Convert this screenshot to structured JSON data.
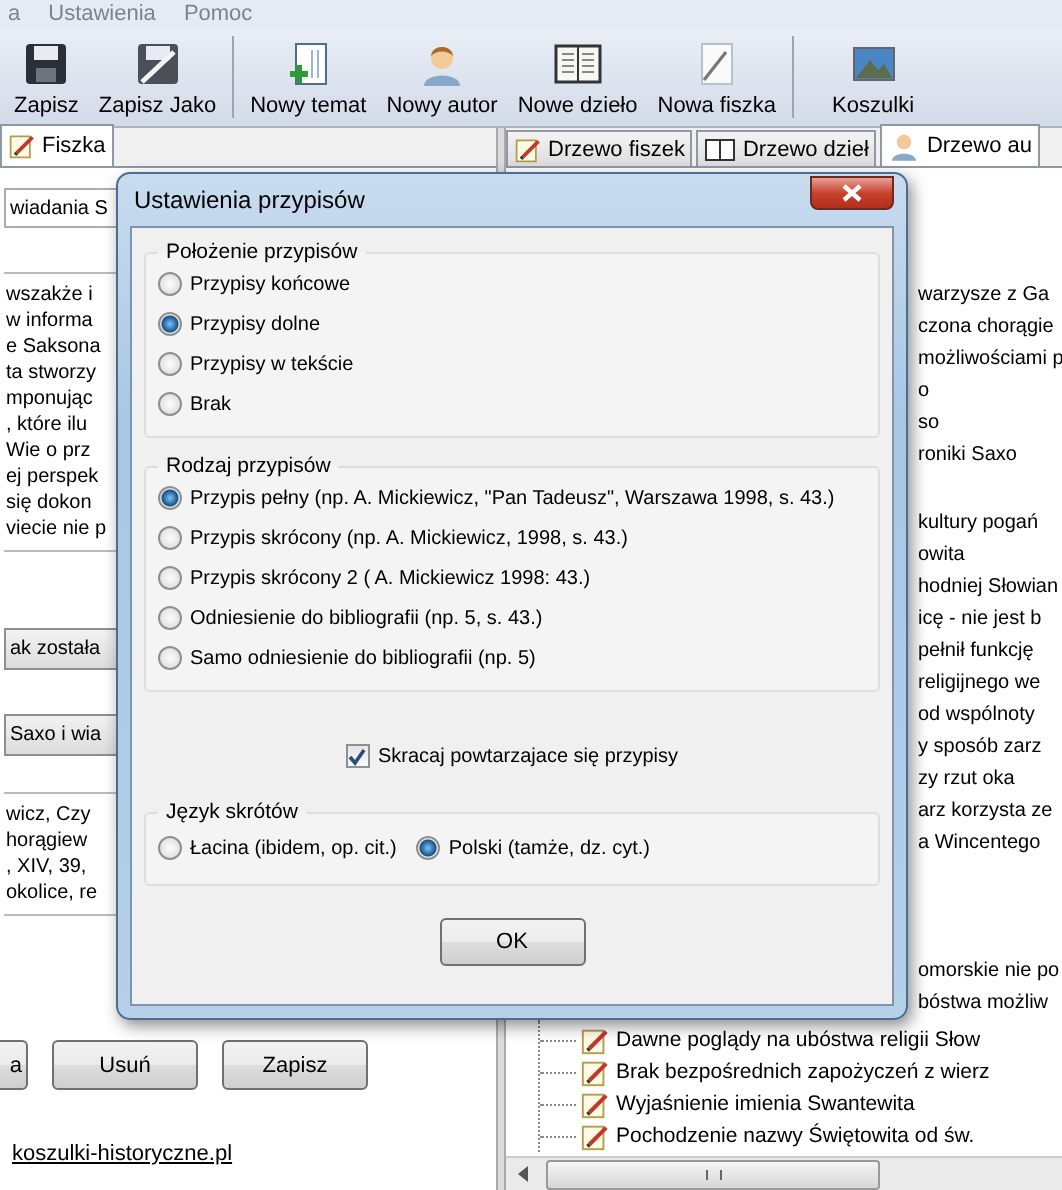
{
  "menu": [
    "a",
    "Ustawienia",
    "Pomoc"
  ],
  "toolbar": {
    "groups": [
      [
        "Zapisz",
        "Zapisz Jako"
      ],
      [
        "Nowy temat",
        "Nowy autor",
        "Nowe dzieło",
        "Nowa fiszka"
      ],
      [
        "Koszulki"
      ]
    ]
  },
  "left_panel": {
    "tabs": [
      {
        "label": "Fiszka",
        "selected": true
      }
    ],
    "title_field": "wiadania S",
    "text_lines": [
      "wszakże i",
      "w informa",
      "e Saksona",
      "ta stworzy",
      "mponując",
      ", które ilu",
      "Wie o prz",
      "ej perspek",
      "się dokon",
      "viecie nie p"
    ],
    "field_1": "ak została",
    "field_2": "Saxo i wia",
    "source_lines": [
      "wicz, Czy",
      "horągiew",
      ", XIV, 39,",
      "okolice, re"
    ],
    "buttons": [
      "a",
      "Usuń",
      "Zapisz"
    ],
    "link": "koszulki-historyczne.pl"
  },
  "right_panel": {
    "tabs": [
      {
        "label": "Drzewo fiszek",
        "selected": false
      },
      {
        "label": "Drzewo dzieł",
        "selected": false
      },
      {
        "label": "Drzewo au",
        "selected": true
      }
    ],
    "tree_row_groups": [
      [
        "warzysze z Ga",
        "czona chorągie",
        "możliwościami p",
        "o",
        "so",
        "roniki Saxo"
      ],
      [
        "kultury pogań",
        "owita",
        "hodniej Słowian",
        "icę - nie jest b",
        "pełnił funkcję",
        "religijnego we",
        "od wspólnoty",
        "y sposób zarz",
        "zy rzut oka",
        "arz korzysta ze",
        "a Wincentego"
      ],
      [
        "omorskie nie po",
        "bóstwa możliw"
      ]
    ],
    "tree_items": [
      "Dawne poglądy na ubóstwa religii Słow",
      "Brak bezpośrednich zapożyczeń z wierz",
      "Wyjaśnienie imienia Swantewita",
      "Pochodzenie nazwy Świętowita od św."
    ]
  },
  "dialog": {
    "title": "Ustawienia przypisów",
    "sections": [
      {
        "kind": "radio_column",
        "legend": "Położenie przypisów",
        "options": [
          {
            "label": "Przypisy końcowe",
            "selected": false
          },
          {
            "label": "Przypisy dolne",
            "selected": true
          },
          {
            "label": "Przypisy w tekście",
            "selected": false
          },
          {
            "label": "Brak",
            "selected": false
          }
        ]
      },
      {
        "kind": "radio_column",
        "legend": "Rodzaj przypisów",
        "options": [
          {
            "label": "Przypis pełny (np. A. Mickiewicz, \"Pan Tadeusz\", Warszawa 1998, s. 43.)",
            "selected": true
          },
          {
            "label": "Przypis skrócony (np. A. Mickiewicz, 1998, s. 43.)",
            "selected": false
          },
          {
            "label": "Przypis skrócony 2 ( A. Mickiewicz 1998: 43.)",
            "selected": false
          },
          {
            "label": "Odniesienie do bibliografii (np. 5, s. 43.)",
            "selected": false
          },
          {
            "label": "Samo odniesienie do bibliografii (np. 5)",
            "selected": false
          }
        ]
      },
      {
        "kind": "checkbox",
        "label": "Skracaj powtarzajace się przypisy",
        "checked": true
      },
      {
        "kind": "radio_row",
        "legend": "Język skrótów",
        "options": [
          {
            "label": "Łacina (ibidem, op. cit.)",
            "selected": false
          },
          {
            "label": "Polski  (tamże, dz. cyt.)",
            "selected": true
          }
        ]
      }
    ],
    "ok_button": "OK"
  }
}
